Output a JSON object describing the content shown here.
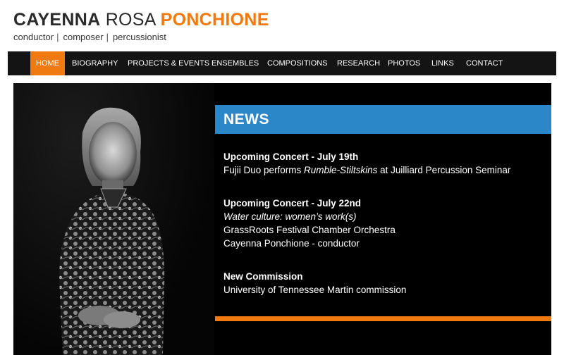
{
  "site": {
    "title_first": "CAYENNA",
    "title_middle": "ROSA",
    "title_last": "PONCHIONE",
    "tagline": [
      "conductor",
      "composer",
      "percussionist"
    ],
    "tagline_separator": "|"
  },
  "nav": {
    "items": [
      {
        "label": "HOME",
        "active": true
      },
      {
        "label": "BIOGRAPHY"
      },
      {
        "label": "PROJECTS & EVENTS"
      },
      {
        "label": "ENSEMBLES"
      },
      {
        "label": "COMPOSITIONS"
      },
      {
        "label": "RESEARCH"
      },
      {
        "label": "PHOTOS"
      },
      {
        "label": "LINKS"
      },
      {
        "label": "CONTACT"
      }
    ]
  },
  "news": {
    "heading": "NEWS",
    "items": [
      {
        "title": "Upcoming Concert - July 19th",
        "line1_pre": "Fujii Duo performs ",
        "line1_ital": "Rumble-Stiltskins",
        "line1_post": " at Juilliard Percussion Seminar"
      },
      {
        "title": "Upcoming Concert - July 22nd",
        "subtitle": "Water culture: women’s work(s)",
        "line2": "GrassRoots Festival Chamber Orchestra",
        "line3": "Cayenna Ponchione - conductor"
      },
      {
        "title": "New Commission",
        "line1": "University of Tennessee Martin commission"
      }
    ]
  },
  "colors": {
    "accent_orange": "#f07a10",
    "news_blue": "#2c87c8",
    "nav_bg": "#141414"
  },
  "portrait": {
    "icon": "portrait-photo"
  }
}
